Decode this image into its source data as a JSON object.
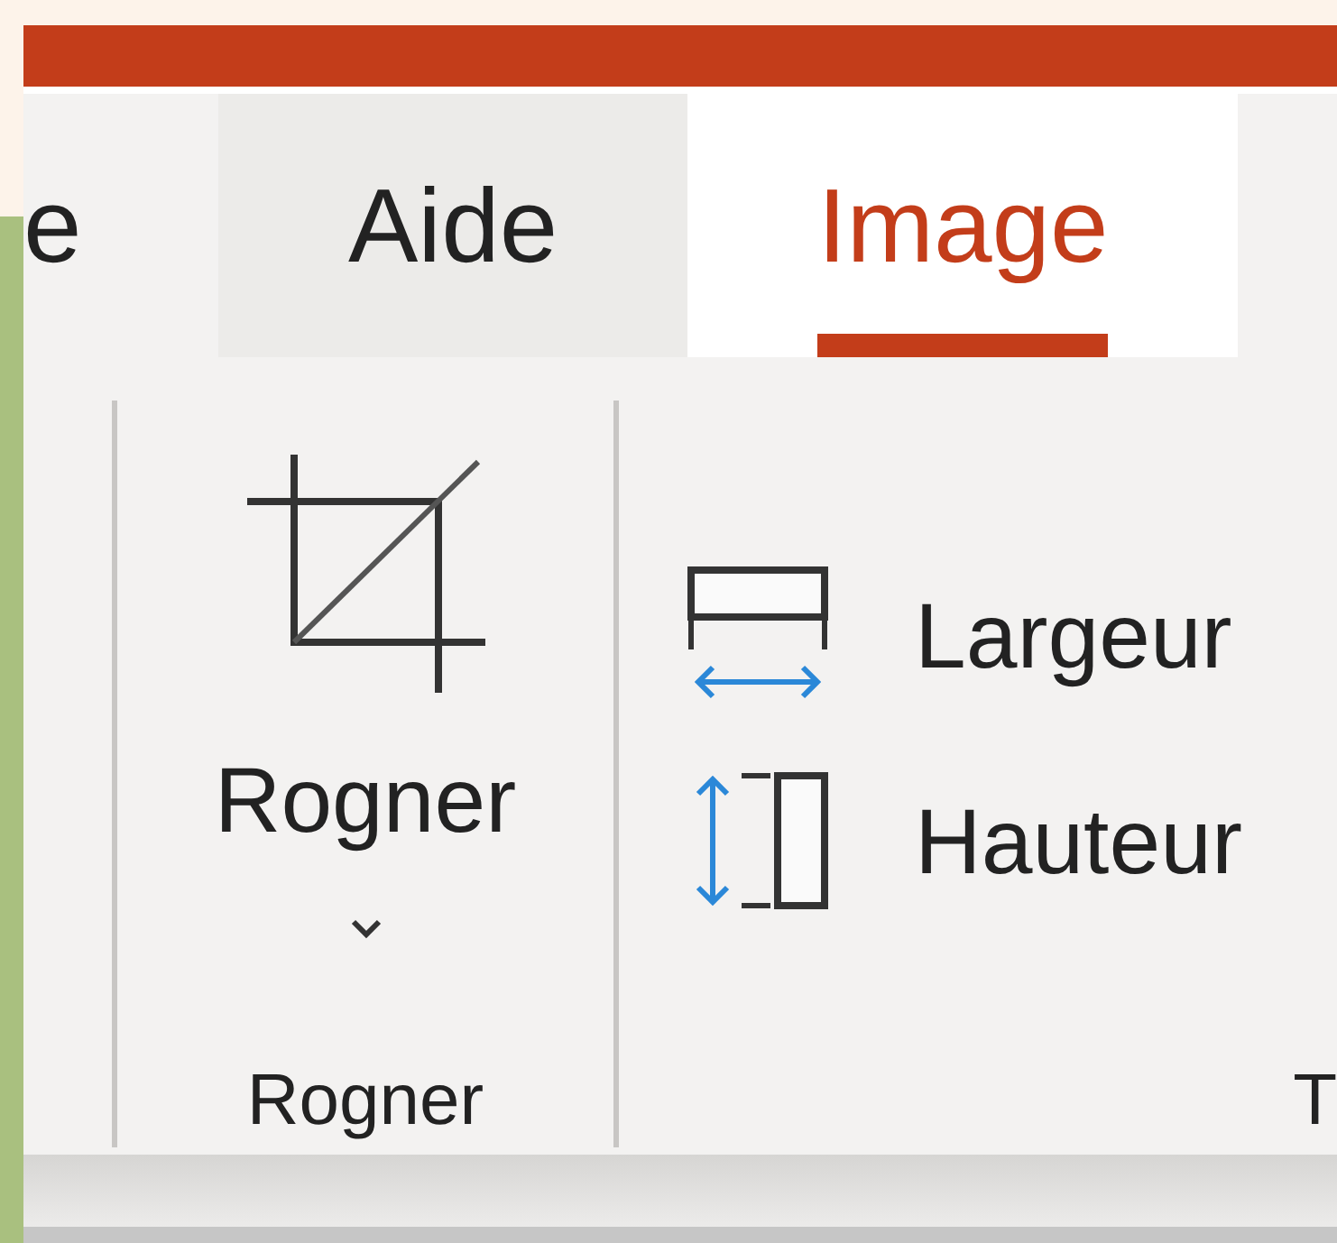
{
  "tabs": [
    {
      "label": "e",
      "selected": false
    },
    {
      "label": "Aide",
      "selected": false
    },
    {
      "label": "Image",
      "selected": true
    }
  ],
  "groups": [
    {
      "kind": "large",
      "button": {
        "label": "Rogner",
        "dropdown": true
      },
      "label": "Rogner"
    },
    {
      "kind": "size",
      "rows": [
        {
          "kind": "width",
          "label": "Largeur"
        },
        {
          "kind": "height",
          "label": "Hauteur"
        }
      ],
      "label": "T"
    }
  ]
}
